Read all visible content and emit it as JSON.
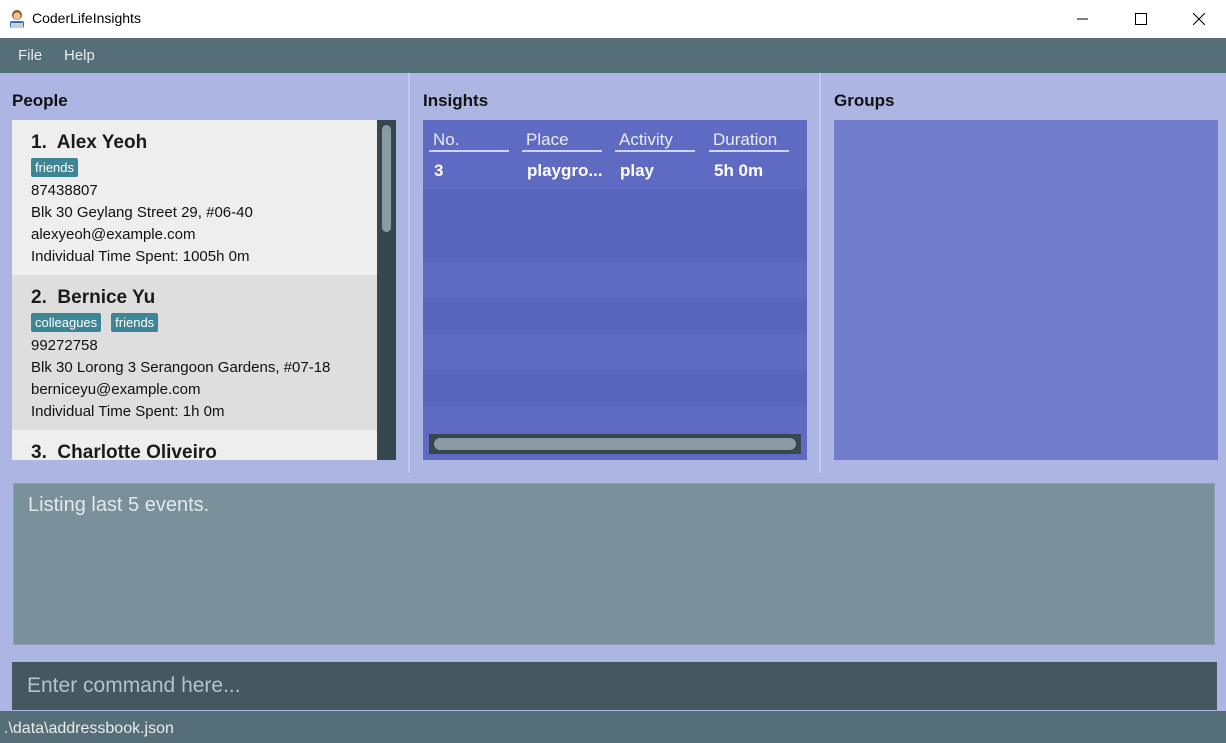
{
  "window": {
    "title": "CoderLifeInsights",
    "icon": "coder-person-icon"
  },
  "menu": {
    "items": [
      "File",
      "Help"
    ]
  },
  "panels": {
    "people_title": "People",
    "insights_title": "Insights",
    "groups_title": "Groups"
  },
  "people": [
    {
      "index": "1.",
      "name": "Alex Yeoh",
      "tags": [
        "friends"
      ],
      "phone": "87438807",
      "address": "Blk 30 Geylang Street 29, #06-40",
      "email": "alexyeoh@example.com",
      "time_spent": "Individual Time Spent: 1005h 0m"
    },
    {
      "index": "2.",
      "name": "Bernice Yu",
      "tags": [
        "colleagues",
        "friends"
      ],
      "phone": "99272758",
      "address": "Blk 30 Lorong 3 Serangoon Gardens, #07-18",
      "email": "berniceyu@example.com",
      "time_spent": "Individual Time Spent: 1h 0m"
    },
    {
      "index": "3.",
      "name": "Charlotte Oliveiro"
    }
  ],
  "insights": {
    "columns": [
      "No.",
      "Place",
      "Activity",
      "Duration"
    ],
    "rows": [
      [
        "3",
        "playgro...",
        "play",
        "5h 0m"
      ]
    ]
  },
  "result": {
    "text": "Listing last 5 events."
  },
  "command": {
    "placeholder": "Enter command here..."
  },
  "status": {
    "path": ".\\data\\addressbook.json"
  },
  "colors": {
    "tag": "#3e8696",
    "menubar": "#566e78",
    "insights_bg": "#5f6bc3",
    "groups_bg": "#717ccc",
    "panel_bg": "#adb5e3"
  }
}
